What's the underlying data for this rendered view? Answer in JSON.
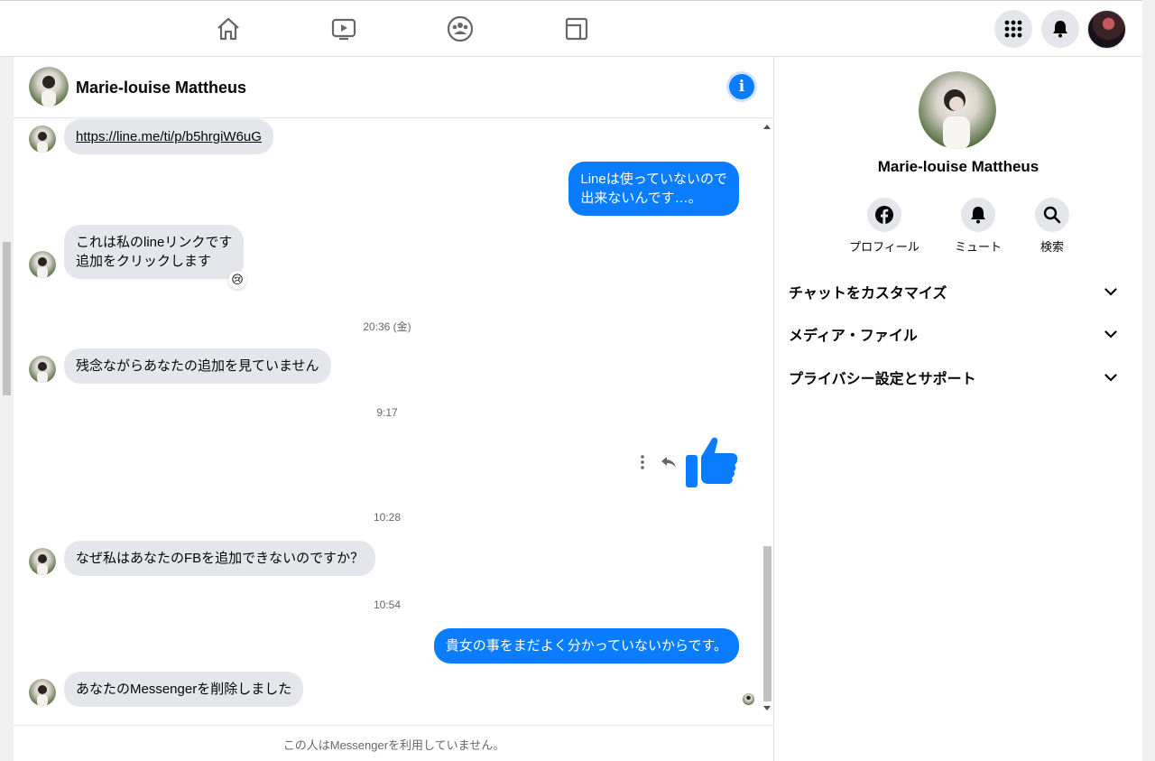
{
  "nav": {
    "icons": [
      "home-icon",
      "watch-icon",
      "groups-icon",
      "gaming-icon"
    ],
    "right_icons": [
      "menu-grid-icon",
      "notifications-bell-icon"
    ]
  },
  "chat": {
    "contact_name": "Marie-louise Mattheus",
    "messages": [
      {
        "type": "in",
        "text": "https://line.me/ti/p/b5hrgiW6uG"
      },
      {
        "type": "out",
        "text": "Lineは使っていないので\n出来ないんです…。"
      },
      {
        "type": "in",
        "text": "これは私のlineリンクです\n追加をクリックします",
        "reaction": "😢"
      },
      {
        "type": "time",
        "text": "20:36 (金)"
      },
      {
        "type": "in",
        "text": "残念ながらあなたの追加を見ていません"
      },
      {
        "type": "time",
        "text": "9:17"
      },
      {
        "type": "out-like"
      },
      {
        "type": "time",
        "text": "10:28"
      },
      {
        "type": "in",
        "text": "なぜ私はあなたのFBを追加できないのですか？"
      },
      {
        "type": "time",
        "text": "10:54"
      },
      {
        "type": "out",
        "text": "貴女の事をまだよく分かっていないからです。"
      },
      {
        "type": "in",
        "text": "あなたのMessengerを削除しました"
      }
    ],
    "footer_notice": "この人はMessengerを利用していません。"
  },
  "profile_panel": {
    "name": "Marie-louise Mattheus",
    "actions": [
      {
        "label": "プロフィール",
        "icon": "facebook-icon"
      },
      {
        "label": "ミュート",
        "icon": "bell-icon"
      },
      {
        "label": "検索",
        "icon": "search-icon"
      }
    ],
    "sections": [
      {
        "label": "チャットをカスタマイズ"
      },
      {
        "label": "メディア・ファイル"
      },
      {
        "label": "プライバシー設定とサポート"
      }
    ]
  },
  "colors": {
    "accent": "#0a7cff",
    "incoming_bubble": "#e4e6eb",
    "muted_text": "#65676b"
  }
}
